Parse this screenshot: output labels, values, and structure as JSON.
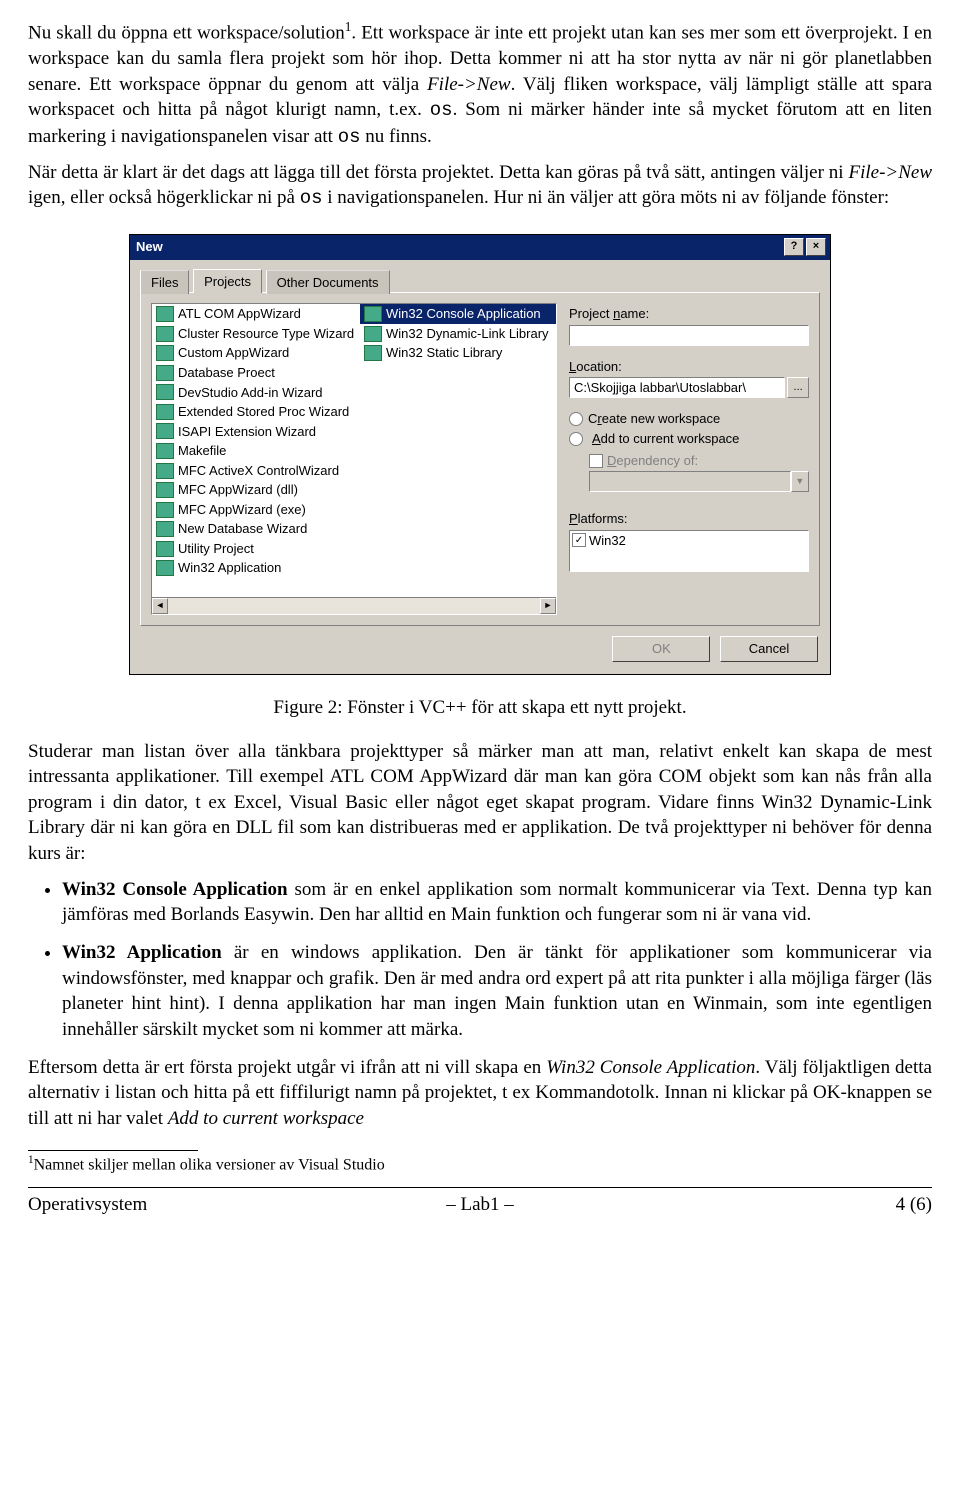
{
  "para1_a": "Nu skall du öppna ett workspace/solution",
  "para1_sup": "1",
  "para1_b": ". Ett workspace är inte ett projekt utan kan ses mer som ett överprojekt. I en workspace kan du samla flera projekt som hör ihop. Detta kommer ni att ha stor nytta av när ni gör planetlabben senare. Ett workspace öppnar du genom att välja ",
  "para1_it1": "File->New",
  "para1_c": ". Välj fliken workspace, välj lämpligt ställe att spara workspacet och hitta på något klurigt namn, t.ex. ",
  "para1_tt1": "os",
  "para1_d": ". Som ni märker händer inte så mycket förutom att en liten markering i navigationspanelen visar att ",
  "para1_tt2": "os",
  "para1_e": " nu finns.",
  "para2_a": "När detta är klart är det dags att lägga till det första projektet. Detta kan göras på två sätt, antingen väljer ni ",
  "para2_it1": "File->New",
  "para2_b": " igen, eller också högerklickar ni på ",
  "para2_tt1": "os",
  "para2_c": " i navigationspanelen. Hur ni än väljer att göra möts ni av följande fönster:",
  "dialog": {
    "title": "New",
    "help": "?",
    "close": "×",
    "tabs": [
      "Files",
      "Projects",
      "Other Documents"
    ],
    "left_items": [
      "ATL COM AppWizard",
      "Cluster Resource Type Wizard",
      "Custom AppWizard",
      "Database Proect",
      "DevStudio Add-in Wizard",
      "Extended Stored Proc Wizard",
      "ISAPI Extension Wizard",
      "Makefile",
      "MFC ActiveX ControlWizard",
      "MFC AppWizard (dll)",
      "MFC AppWizard (exe)",
      "New Database Wizard",
      "Utility Project",
      "Win32 Application",
      "Win32 Console Application",
      "Win32 Dynamic-Link Library"
    ],
    "right_extra": "Win32 Static Library",
    "project_name_label": "Project name:",
    "project_name_value": "",
    "location_label": "Location:",
    "location_value": "C:\\Skojjiga labbar\\Utoslabbar\\",
    "browse": "...",
    "radio_new": "Create new workspace",
    "radio_add": "Add to current workspace",
    "dep_label": "Dependency of:",
    "platforms_label": "Platforms:",
    "platform_item": "Win32",
    "ok": "OK",
    "cancel": "Cancel"
  },
  "caption": "Figure 2: Fönster i VC++ för att skapa ett nytt projekt.",
  "para3": "Studerar man listan över alla tänkbara projekttyper så märker man att man, relativt enkelt kan skapa de mest intressanta applikationer. Till exempel ATL COM AppWizard där man kan göra COM objekt som kan nås från alla program i din dator, t ex Excel, Visual Basic eller något eget skapat program. Vidare finns Win32 Dynamic-Link Library där ni kan göra en DLL fil som kan distribueras med er applikation. De två projekttyper ni behöver för denna kurs är:",
  "bullet1_b": "Win32 Console Application",
  "bullet1_t": " som är en enkel applikation som normalt kommunicerar via Text. Denna typ kan jämföras med Borlands Easywin. Den har alltid en Main funktion och fungerar som ni är vana vid.",
  "bullet2_b": "Win32 Application",
  "bullet2_t": " är en windows applikation. Den är tänkt för applikationer som kommunicerar via windowsfönster, med knappar och grafik. Den är med andra ord expert på att rita punkter i alla möjliga färger (läs planeter hint hint). I denna applikation har man ingen Main funktion utan en Winmain, som inte egentligen innehåller särskilt mycket som ni kommer att märka.",
  "para4_a": "Eftersom detta är ert första projekt utgår vi ifrån att ni vill skapa en ",
  "para4_it1": "Win32 Console Application",
  "para4_b": ". Välj följaktligen detta alternativ i listan och hitta på ett fiffilurigt namn på projektet, t ex Kommandotolk. Innan ni klickar på OK-knappen se till att ni har valet ",
  "para4_it2": "Add to current workspace",
  "footnote_mark": "1",
  "footnote_text": "Namnet skiljer mellan olika versioner av Visual Studio",
  "footer": {
    "left": "Operativsystem",
    "center": "– Lab1 –",
    "right": "4 (6)"
  }
}
